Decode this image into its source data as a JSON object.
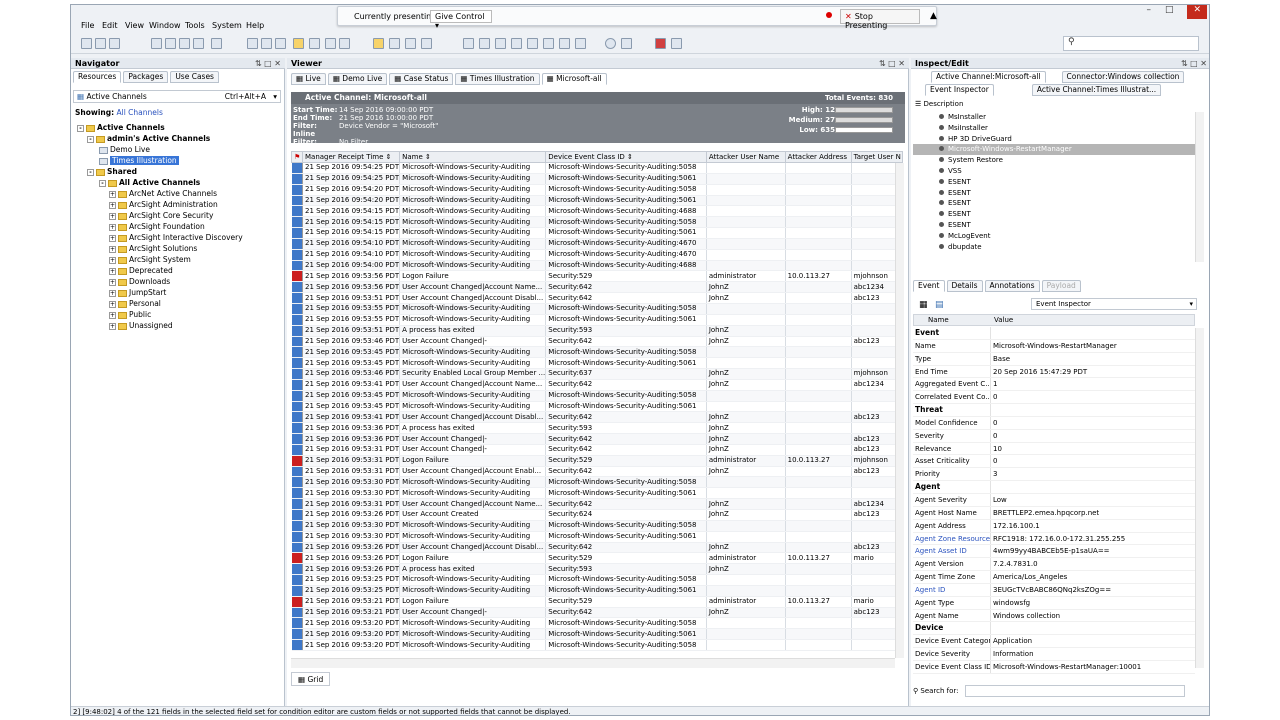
{
  "menu": [
    "File",
    "Edit",
    "View",
    "Window",
    "Tools",
    "System",
    "Help"
  ],
  "presenting": {
    "label": "Currently presenting",
    "control": "Give Control",
    "stop": "Stop Presenting"
  },
  "navigator": {
    "title": "Navigator",
    "tabs": [
      "Resources",
      "Packages",
      "Use Cases"
    ],
    "resource_type": "Active Channels",
    "shortcut": "Ctrl+Alt+A",
    "showing_label": "Showing:",
    "showing_value": "All Channels",
    "tree": [
      {
        "label": "Active Channels",
        "bold": true
      },
      {
        "label": "admin's Active Channels",
        "bold": true
      },
      {
        "label": "Demo Live"
      },
      {
        "label": "Times Illustration",
        "selected": true
      },
      {
        "label": "Shared",
        "bold": true
      },
      {
        "label": "All Active Channels",
        "bold": true
      },
      {
        "label": "ArcNet Active Channels"
      },
      {
        "label": "ArcSight Administration"
      },
      {
        "label": "ArcSight Core Security"
      },
      {
        "label": "ArcSight Foundation"
      },
      {
        "label": "ArcSight Interactive Discovery"
      },
      {
        "label": "ArcSight Solutions"
      },
      {
        "label": "ArcSight System"
      },
      {
        "label": "Deprecated"
      },
      {
        "label": "Downloads"
      },
      {
        "label": "JumpStart"
      },
      {
        "label": "Personal"
      },
      {
        "label": "Public"
      },
      {
        "label": "Unassigned"
      }
    ]
  },
  "viewer": {
    "title": "Viewer",
    "tabs": [
      "Live",
      "Demo Live",
      "Case Status",
      "Times Illustration",
      "Microsoft-all"
    ],
    "channel_title": "Active Channel: Microsoft-all",
    "total": "Total Events: 830",
    "start_label": "Start Time:",
    "start": "14 Sep 2016 09:00:00 PDT",
    "end_label": "End Time:",
    "end": "21 Sep 2016 10:00:00 PDT",
    "filter_label": "Filter:",
    "filter": "Device Vendor = \"Microsoft\"",
    "inline_label": "Inline Filter:",
    "inline": "No Filter",
    "sev_high": "High:  12",
    "sev_medium": "Medium:  27",
    "sev_low": "Low:  635",
    "columns": [
      "",
      "Manager Receipt Time",
      "Name",
      "Device Event Class ID",
      "Attacker User Name",
      "Attacker Address",
      "Target User N"
    ],
    "grid_tab": "Grid",
    "rows": [
      [
        "b",
        "21 Sep 2016 09:54:25 PDT",
        "Microsoft-Windows-Security-Auditing",
        "Microsoft-Windows-Security-Auditing:5058",
        "",
        "",
        ""
      ],
      [
        "b",
        "21 Sep 2016 09:54:25 PDT",
        "Microsoft-Windows-Security-Auditing",
        "Microsoft-Windows-Security-Auditing:5061",
        "",
        "",
        ""
      ],
      [
        "b",
        "21 Sep 2016 09:54:20 PDT",
        "Microsoft-Windows-Security-Auditing",
        "Microsoft-Windows-Security-Auditing:5058",
        "",
        "",
        ""
      ],
      [
        "b",
        "21 Sep 2016 09:54:20 PDT",
        "Microsoft-Windows-Security-Auditing",
        "Microsoft-Windows-Security-Auditing:5061",
        "",
        "",
        ""
      ],
      [
        "b",
        "21 Sep 2016 09:54:15 PDT",
        "Microsoft-Windows-Security-Auditing",
        "Microsoft-Windows-Security-Auditing:4688",
        "",
        "",
        ""
      ],
      [
        "b",
        "21 Sep 2016 09:54:15 PDT",
        "Microsoft-Windows-Security-Auditing",
        "Microsoft-Windows-Security-Auditing:5058",
        "",
        "",
        ""
      ],
      [
        "b",
        "21 Sep 2016 09:54:15 PDT",
        "Microsoft-Windows-Security-Auditing",
        "Microsoft-Windows-Security-Auditing:5061",
        "",
        "",
        ""
      ],
      [
        "b",
        "21 Sep 2016 09:54:10 PDT",
        "Microsoft-Windows-Security-Auditing",
        "Microsoft-Windows-Security-Auditing:4670",
        "",
        "",
        ""
      ],
      [
        "b",
        "21 Sep 2016 09:54:10 PDT",
        "Microsoft-Windows-Security-Auditing",
        "Microsoft-Windows-Security-Auditing:4670",
        "",
        "",
        ""
      ],
      [
        "b",
        "21 Sep 2016 09:54:00 PDT",
        "Microsoft-Windows-Security-Auditing",
        "Microsoft-Windows-Security-Auditing:4688",
        "",
        "",
        ""
      ],
      [
        "r",
        "21 Sep 2016 09:53:56 PDT",
        "Logon Failure",
        "Security:529",
        "administrator",
        "10.0.113.27",
        "mjohnson"
      ],
      [
        "b",
        "21 Sep 2016 09:53:56 PDT",
        "User Account Changed|Account Name...",
        "Security:642",
        "JohnZ",
        "",
        "abc1234"
      ],
      [
        "b",
        "21 Sep 2016 09:53:51 PDT",
        "User Account Changed|Account Disabl...",
        "Security:642",
        "JohnZ",
        "",
        "abc123"
      ],
      [
        "b",
        "21 Sep 2016 09:53:55 PDT",
        "Microsoft-Windows-Security-Auditing",
        "Microsoft-Windows-Security-Auditing:5058",
        "",
        "",
        ""
      ],
      [
        "b",
        "21 Sep 2016 09:53:55 PDT",
        "Microsoft-Windows-Security-Auditing",
        "Microsoft-Windows-Security-Auditing:5061",
        "",
        "",
        ""
      ],
      [
        "b",
        "21 Sep 2016 09:53:51 PDT",
        "A process has exited",
        "Security:593",
        "JohnZ",
        "",
        ""
      ],
      [
        "b",
        "21 Sep 2016 09:53:46 PDT",
        "User Account Changed|-",
        "Security:642",
        "JohnZ",
        "",
        "abc123"
      ],
      [
        "b",
        "21 Sep 2016 09:53:45 PDT",
        "Microsoft-Windows-Security-Auditing",
        "Microsoft-Windows-Security-Auditing:5058",
        "",
        "",
        ""
      ],
      [
        "b",
        "21 Sep 2016 09:53:45 PDT",
        "Microsoft-Windows-Security-Auditing",
        "Microsoft-Windows-Security-Auditing:5061",
        "",
        "",
        ""
      ],
      [
        "b",
        "21 Sep 2016 09:53:46 PDT",
        "Security Enabled Local Group Member ...",
        "Security:637",
        "JohnZ",
        "",
        "mjohnson"
      ],
      [
        "b",
        "21 Sep 2016 09:53:41 PDT",
        "User Account Changed|Account Name...",
        "Security:642",
        "JohnZ",
        "",
        "abc1234"
      ],
      [
        "b",
        "21 Sep 2016 09:53:45 PDT",
        "Microsoft-Windows-Security-Auditing",
        "Microsoft-Windows-Security-Auditing:5058",
        "",
        "",
        ""
      ],
      [
        "b",
        "21 Sep 2016 09:53:45 PDT",
        "Microsoft-Windows-Security-Auditing",
        "Microsoft-Windows-Security-Auditing:5061",
        "",
        "",
        ""
      ],
      [
        "b",
        "21 Sep 2016 09:53:41 PDT",
        "User Account Changed|Account Disabl...",
        "Security:642",
        "JohnZ",
        "",
        "abc123"
      ],
      [
        "b",
        "21 Sep 2016 09:53:36 PDT",
        "A process has exited",
        "Security:593",
        "JohnZ",
        "",
        ""
      ],
      [
        "b",
        "21 Sep 2016 09:53:36 PDT",
        "User Account Changed|-",
        "Security:642",
        "JohnZ",
        "",
        "abc123"
      ],
      [
        "b",
        "21 Sep 2016 09:53:31 PDT",
        "User Account Changed|-",
        "Security:642",
        "JohnZ",
        "",
        "abc123"
      ],
      [
        "r",
        "21 Sep 2016 09:53:31 PDT",
        "Logon Failure",
        "Security:529",
        "administrator",
        "10.0.113.27",
        "mjohnson"
      ],
      [
        "b",
        "21 Sep 2016 09:53:31 PDT",
        "User Account Changed|Account Enabl...",
        "Security:642",
        "JohnZ",
        "",
        "abc123"
      ],
      [
        "b",
        "21 Sep 2016 09:53:30 PDT",
        "Microsoft-Windows-Security-Auditing",
        "Microsoft-Windows-Security-Auditing:5058",
        "",
        "",
        ""
      ],
      [
        "b",
        "21 Sep 2016 09:53:30 PDT",
        "Microsoft-Windows-Security-Auditing",
        "Microsoft-Windows-Security-Auditing:5061",
        "",
        "",
        ""
      ],
      [
        "b",
        "21 Sep 2016 09:53:31 PDT",
        "User Account Changed|Account Name...",
        "Security:642",
        "JohnZ",
        "",
        "abc1234"
      ],
      [
        "b",
        "21 Sep 2016 09:53:26 PDT",
        "User Account Created",
        "Security:624",
        "JohnZ",
        "",
        "abc123"
      ],
      [
        "b",
        "21 Sep 2016 09:53:30 PDT",
        "Microsoft-Windows-Security-Auditing",
        "Microsoft-Windows-Security-Auditing:5058",
        "",
        "",
        ""
      ],
      [
        "b",
        "21 Sep 2016 09:53:30 PDT",
        "Microsoft-Windows-Security-Auditing",
        "Microsoft-Windows-Security-Auditing:5061",
        "",
        "",
        ""
      ],
      [
        "b",
        "21 Sep 2016 09:53:26 PDT",
        "User Account Changed|Account Disabl...",
        "Security:642",
        "JohnZ",
        "",
        "abc123"
      ],
      [
        "r",
        "21 Sep 2016 09:53:26 PDT",
        "Logon Failure",
        "Security:529",
        "administrator",
        "10.0.113.27",
        "mario"
      ],
      [
        "b",
        "21 Sep 2016 09:53:26 PDT",
        "A process has exited",
        "Security:593",
        "JohnZ",
        "",
        ""
      ],
      [
        "b",
        "21 Sep 2016 09:53:25 PDT",
        "Microsoft-Windows-Security-Auditing",
        "Microsoft-Windows-Security-Auditing:5058",
        "",
        "",
        ""
      ],
      [
        "b",
        "21 Sep 2016 09:53:25 PDT",
        "Microsoft-Windows-Security-Auditing",
        "Microsoft-Windows-Security-Auditing:5061",
        "",
        "",
        ""
      ],
      [
        "r",
        "21 Sep 2016 09:53:21 PDT",
        "Logon Failure",
        "Security:529",
        "administrator",
        "10.0.113.27",
        "mario"
      ],
      [
        "b",
        "21 Sep 2016 09:53:21 PDT",
        "User Account Changed|-",
        "Security:642",
        "JohnZ",
        "",
        "abc123"
      ],
      [
        "b",
        "21 Sep 2016 09:53:20 PDT",
        "Microsoft-Windows-Security-Auditing",
        "Microsoft-Windows-Security-Auditing:5058",
        "",
        "",
        ""
      ],
      [
        "b",
        "21 Sep 2016 09:53:20 PDT",
        "Microsoft-Windows-Security-Auditing",
        "Microsoft-Windows-Security-Auditing:5061",
        "",
        "",
        ""
      ],
      [
        "b",
        "21 Sep 2016 09:53:20 PDT",
        "Microsoft-Windows-Security-Auditing",
        "Microsoft-Windows-Security-Auditing:5058",
        "",
        "",
        ""
      ]
    ]
  },
  "inspect": {
    "title": "Inspect/Edit",
    "tabs_top": [
      "Active Channel:Microsoft-all",
      "Connector:Windows collection"
    ],
    "tabs_second": [
      "Event Inspector",
      "Active Channel:Times Illustrat..."
    ],
    "description": "Description",
    "tree": [
      "MsInstaller",
      "MsiInstaller",
      "HP 3D DriveGuard",
      "Microsoft-Windows-RestartManager",
      "System Restore",
      "VSS",
      "ESENT",
      "ESENT",
      "ESENT",
      "ESENT",
      "ESENT",
      "McLogEvent",
      "dbupdate"
    ],
    "tree_selected": 3,
    "event_tabs": [
      "Event",
      "Details",
      "Annotations",
      "Payload"
    ],
    "inspector_select": "Event Inspector",
    "col_name": "Name",
    "col_value": "Value",
    "rows": [
      {
        "n": "Event",
        "v": "",
        "sec": true
      },
      {
        "n": "Name",
        "v": "Microsoft-Windows-RestartManager"
      },
      {
        "n": "Type",
        "v": "Base"
      },
      {
        "n": "End Time",
        "v": "20 Sep 2016 15:47:29 PDT"
      },
      {
        "n": "Aggregated Event C...",
        "v": "1"
      },
      {
        "n": "Correlated Event Co...",
        "v": "0"
      },
      {
        "n": "Threat",
        "v": "",
        "sec": true
      },
      {
        "n": "Model Confidence",
        "v": "0"
      },
      {
        "n": "Severity",
        "v": "0"
      },
      {
        "n": "Relevance",
        "v": "10"
      },
      {
        "n": "Asset Criticality",
        "v": "0"
      },
      {
        "n": "Priority",
        "v": "3"
      },
      {
        "n": "Agent",
        "v": "",
        "sec": true
      },
      {
        "n": "Agent Severity",
        "v": "Low"
      },
      {
        "n": "Agent Host Name",
        "v": "BRETTLEP2.emea.hpqcorp.net"
      },
      {
        "n": "Agent Address",
        "v": "172.16.100.1"
      },
      {
        "n": "Agent Zone Resource",
        "v": "RFC1918: 172.16.0.0-172.31.255.255",
        "link": true
      },
      {
        "n": "Agent Asset ID",
        "v": "4wm99yy4BABCEb5E-p1saUA==",
        "link": true
      },
      {
        "n": "Agent Version",
        "v": "7.2.4.7831.0"
      },
      {
        "n": "Agent Time Zone",
        "v": "America/Los_Angeles"
      },
      {
        "n": "Agent ID",
        "v": "3EUGcTVcBABC86QNq2ksZOg==",
        "link": true
      },
      {
        "n": "Agent Type",
        "v": "windowsfg"
      },
      {
        "n": "Agent Name",
        "v": "Windows collection"
      },
      {
        "n": "Device",
        "v": "",
        "sec": true
      },
      {
        "n": "Device Event Category",
        "v": "Application"
      },
      {
        "n": "Device Severity",
        "v": "Information"
      },
      {
        "n": "Device Event Class ID",
        "v": "Microsoft-Windows-RestartManager:10001"
      }
    ],
    "search_label": "Search for:"
  },
  "status_text": "2] [9:48:02] 4 of the 121 fields in the selected field set for condition editor are custom fields or not supported fields that cannot be displayed.",
  "colors": {
    "priority_red": "#cc1f1f",
    "priority_blue": "#3f78c8",
    "selection": "#3875d7"
  }
}
